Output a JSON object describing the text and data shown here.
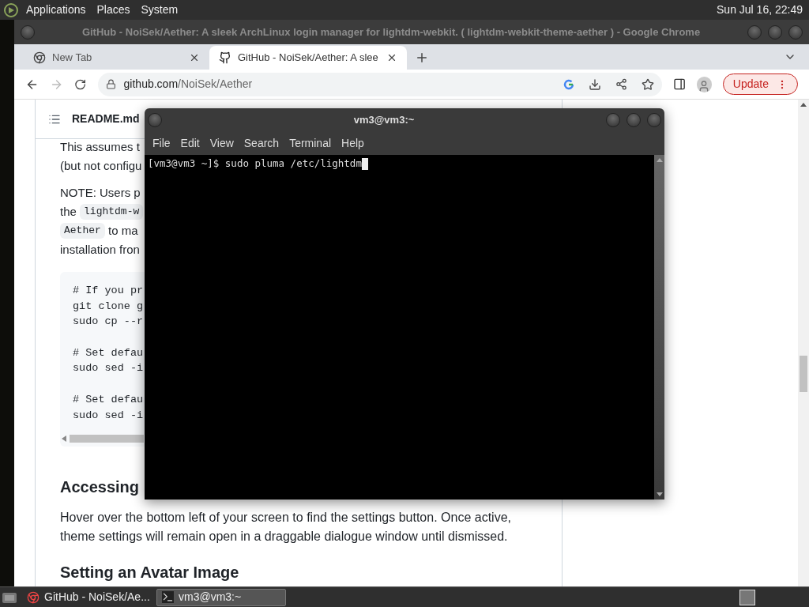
{
  "top_panel": {
    "menus": [
      "Applications",
      "Places",
      "System"
    ],
    "clock": "Sun Jul 16, 22:49"
  },
  "browser": {
    "title": "GitHub - NoiSek/Aether: A sleek ArchLinux login manager for lightdm-webkit. ( lightdm-webkit-theme-aether ) - Google Chrome",
    "tabs": [
      {
        "label": "New Tab",
        "kind": "chrome",
        "selected": false
      },
      {
        "label": "GitHub - NoiSek/Aether: A slee",
        "kind": "github",
        "selected": true
      }
    ],
    "nav": {
      "back_disabled": false,
      "forward_disabled": true
    },
    "url": {
      "host": "github.com",
      "path": "/NoiSek/Aether"
    },
    "update_label": "Update"
  },
  "readme": {
    "header": "README.md",
    "paragraphs": [
      {
        "lines": [
          [
            {
              "kind": "text",
              "text": "This assumes t"
            }
          ],
          [
            {
              "kind": "text",
              "text": "(but not configu"
            }
          ]
        ]
      },
      {
        "lines": [
          [
            {
              "kind": "text",
              "text": "NOTE: Users p"
            }
          ],
          [
            {
              "kind": "text",
              "text": "the "
            },
            {
              "kind": "code",
              "text": "lightdm-w"
            }
          ],
          [
            {
              "kind": "code",
              "text": "Aether"
            },
            {
              "kind": "text",
              "text": " to ma"
            }
          ],
          [
            {
              "kind": "text",
              "text": "installation fron"
            }
          ]
        ]
      }
    ],
    "code_blocks": [
      [
        "# If you pr",
        "git clone g",
        "sudo cp --r"
      ],
      [
        "# Set defau",
        "sudo sed -i"
      ],
      [
        "# Set defau",
        "sudo sed -i"
      ]
    ],
    "heading": "Accessing",
    "body": "Hover over the bottom left of your screen to find the settings button. Once active, theme settings will remain open in a draggable dialogue window until dismissed.",
    "next_heading": "Setting an Avatar Image"
  },
  "terminal": {
    "title": "vm3@vm3:~",
    "menus": [
      "File",
      "Edit",
      "View",
      "Search",
      "Terminal",
      "Help"
    ],
    "line": "[vm3@vm3 ~]$ sudo pluma /etc/lightdm"
  },
  "taskbar": {
    "tasks": [
      {
        "label": "GitHub - NoiSek/Ae...",
        "kind": "browser",
        "selected": false
      },
      {
        "label": "vm3@vm3:~",
        "kind": "terminal",
        "selected": true
      }
    ]
  }
}
